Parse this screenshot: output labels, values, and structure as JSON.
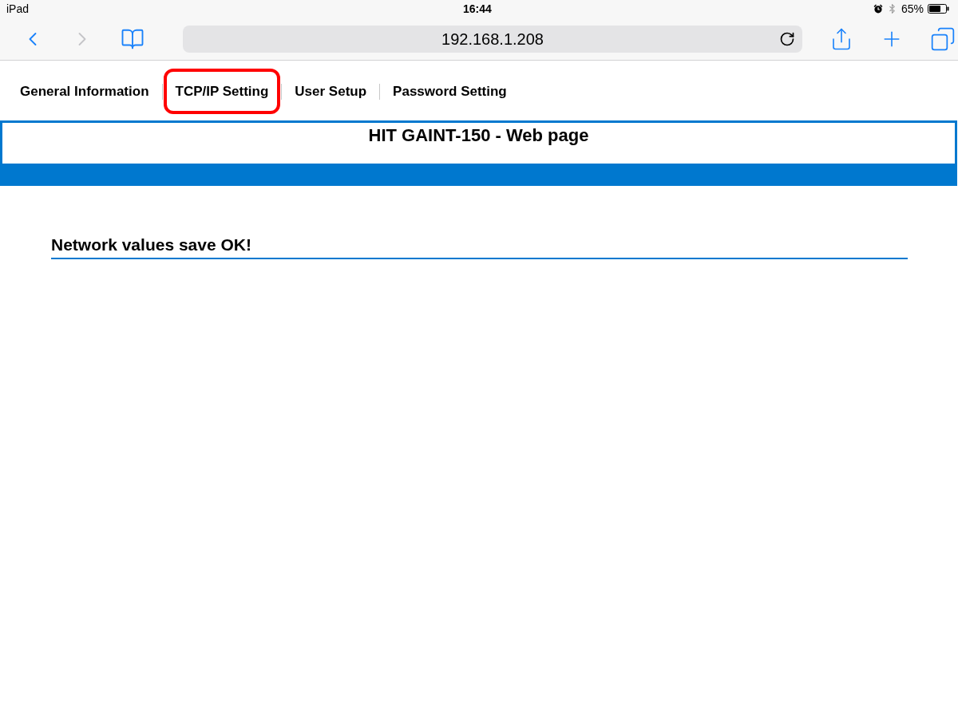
{
  "status_bar": {
    "device": "iPad",
    "time": "16:44",
    "battery": "65%"
  },
  "browser": {
    "back_disabled": false,
    "forward_disabled": true,
    "address": "192.168.1.208"
  },
  "page": {
    "menu": [
      {
        "label": "General Information",
        "highlighted": false
      },
      {
        "label": "TCP/IP Setting",
        "highlighted": true
      },
      {
        "label": "User Setup",
        "highlighted": false
      },
      {
        "label": "Password Setting",
        "highlighted": false
      }
    ],
    "banner_title": "HIT GAINT-150 - Web page",
    "message": "Network values save OK!"
  }
}
